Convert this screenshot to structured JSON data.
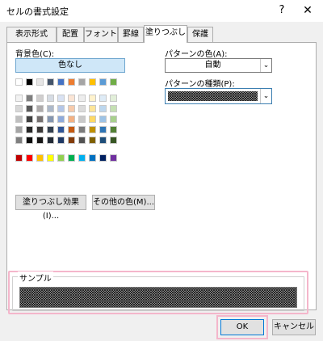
{
  "window": {
    "title": "セルの書式設定",
    "help": "?",
    "close": "✕"
  },
  "tabs": [
    {
      "label": "表示形式"
    },
    {
      "label": "配置"
    },
    {
      "label": "フォント"
    },
    {
      "label": "罫線"
    },
    {
      "label": "塗りつぶし",
      "active": true
    },
    {
      "label": "保護"
    }
  ],
  "background": {
    "label": "背景色(C):",
    "no_color": "色なし",
    "theme_top": [
      "#ffffff",
      "#000000",
      "#e7e6e6",
      "#44546a",
      "#4472c4",
      "#ed7d31",
      "#a5a5a5",
      "#ffc000",
      "#5b9bd5",
      "#70ad47"
    ],
    "theme_shades": [
      [
        "#f2f2f2",
        "#7f7f7f",
        "#d0cece",
        "#d6dce4",
        "#d9e2f3",
        "#fbe5d5",
        "#ededed",
        "#fff2cc",
        "#deebf6",
        "#e2efd9"
      ],
      [
        "#d8d8d8",
        "#595959",
        "#aeabab",
        "#adb9ca",
        "#b4c6e7",
        "#f7cbac",
        "#dbdbdb",
        "#fee599",
        "#bdd7ee",
        "#c5e0b3"
      ],
      [
        "#bfbfbf",
        "#3f3f3f",
        "#757070",
        "#8496b0",
        "#8eaadb",
        "#f4b183",
        "#c9c9c9",
        "#ffd965",
        "#9dc3e6",
        "#a8d08d"
      ],
      [
        "#a5a5a5",
        "#262626",
        "#3a3838",
        "#323f4f",
        "#2f5496",
        "#c55a11",
        "#7b7b7b",
        "#bf9000",
        "#2e75b5",
        "#538135"
      ],
      [
        "#7f7f7f",
        "#0c0c0c",
        "#171616",
        "#222a35",
        "#1e3864",
        "#833c0b",
        "#525252",
        "#7f6000",
        "#1e4e79",
        "#375623"
      ]
    ],
    "standard": [
      "#c00000",
      "#ff0000",
      "#ffc000",
      "#ffff00",
      "#92d050",
      "#00b050",
      "#00b0f0",
      "#0070c0",
      "#002060",
      "#7030a0"
    ]
  },
  "buttons": {
    "fill_effects": "塗りつぶし効果(I)...",
    "more_colors": "その他の色(M)...",
    "ok": "OK",
    "cancel": "キャンセル"
  },
  "pattern": {
    "color_label": "パターンの色(A):",
    "color_value": "自動",
    "style_label": "パターンの種類(P):"
  },
  "sample": {
    "label": "サンプル"
  },
  "colors": {
    "highlight": "#f4b6cb",
    "selected_fill": "#cfe7f8"
  }
}
